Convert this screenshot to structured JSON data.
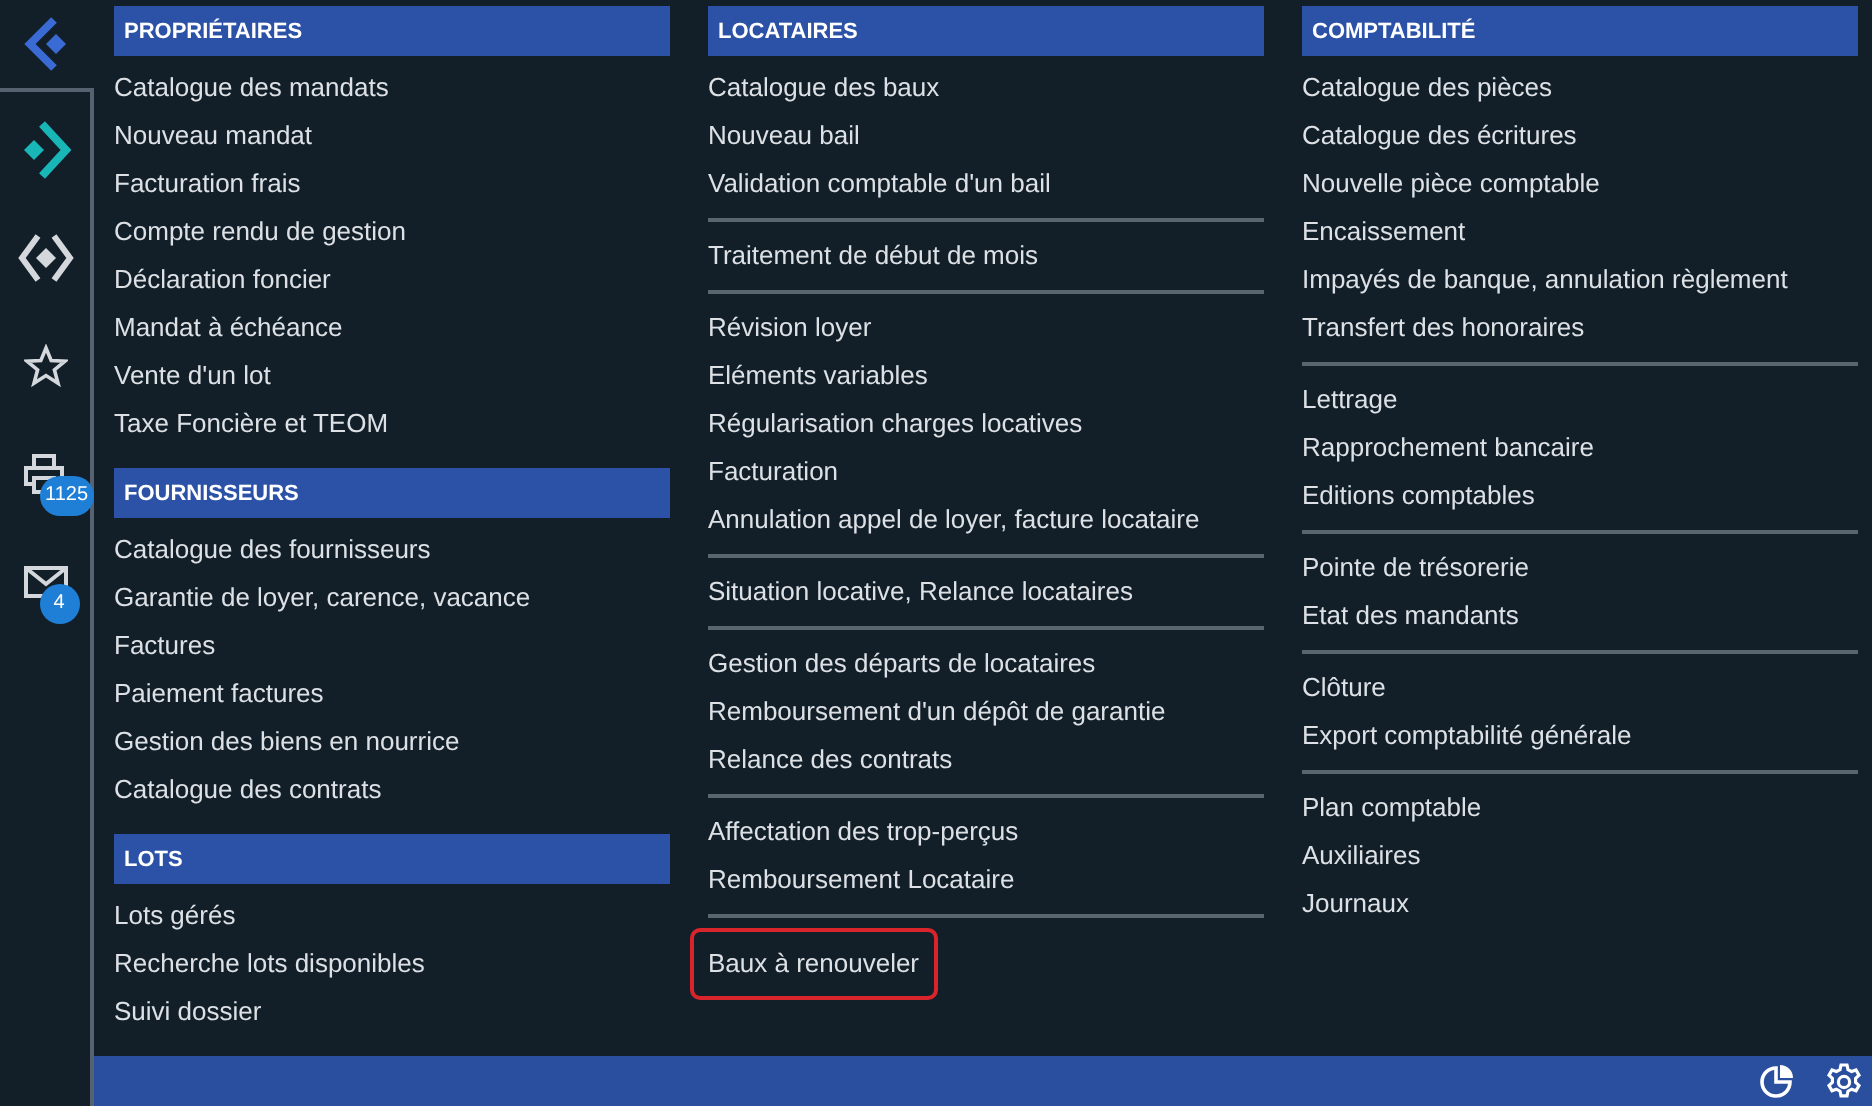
{
  "rail": {
    "items": [
      {
        "kind": "forward",
        "selected": true
      },
      {
        "kind": "diamond",
        "selected": false
      },
      {
        "kind": "star",
        "selected": false
      },
      {
        "kind": "printer",
        "selected": false,
        "badge": "1125"
      },
      {
        "kind": "mail",
        "selected": false,
        "badge": "4"
      }
    ]
  },
  "columns": [
    {
      "sections": [
        {
          "title": "PROPRIÉTAIRES",
          "groups": [
            [
              {
                "label": "Catalogue des mandats",
                "selected": false
              },
              {
                "label": "Nouveau mandat",
                "selected": false
              },
              {
                "label": "Facturation frais",
                "selected": false
              },
              {
                "label": "Compte rendu de gestion",
                "selected": false
              },
              {
                "label": "Déclaration foncier",
                "selected": false
              },
              {
                "label": "Mandat à échéance",
                "selected": false
              },
              {
                "label": "Vente d'un lot",
                "selected": false
              },
              {
                "label": "Taxe Foncière et TEOM",
                "selected": false
              }
            ]
          ]
        },
        {
          "title": "FOURNISSEURS",
          "groups": [
            [
              {
                "label": "Catalogue des fournisseurs",
                "selected": false
              },
              {
                "label": "Garantie de loyer, carence, vacance",
                "selected": false
              },
              {
                "label": "Factures",
                "selected": false
              },
              {
                "label": "Paiement factures",
                "selected": false
              },
              {
                "label": "Gestion des biens en nourrice",
                "selected": false
              },
              {
                "label": "Catalogue des contrats",
                "selected": false
              }
            ]
          ]
        },
        {
          "title": "LOTS",
          "groups": [
            [
              {
                "label": "Lots gérés",
                "selected": false
              },
              {
                "label": "Recherche lots disponibles",
                "selected": false
              },
              {
                "label": "Suivi dossier",
                "selected": false
              }
            ]
          ]
        }
      ]
    },
    {
      "sections": [
        {
          "title": "LOCATAIRES",
          "groups": [
            [
              {
                "label": "Catalogue des baux",
                "selected": false
              },
              {
                "label": "Nouveau bail",
                "selected": false
              },
              {
                "label": "Validation comptable d'un bail",
                "selected": false
              }
            ],
            [
              {
                "label": "Traitement de début de mois",
                "selected": false
              }
            ],
            [
              {
                "label": "Révision loyer",
                "selected": false
              },
              {
                "label": "Eléments variables",
                "selected": false
              },
              {
                "label": "Régularisation charges locatives",
                "selected": false
              },
              {
                "label": "Facturation",
                "selected": false
              },
              {
                "label": "Annulation appel de loyer, facture locataire",
                "selected": false
              }
            ],
            [
              {
                "label": "Situation locative, Relance locataires",
                "selected": false
              }
            ],
            [
              {
                "label": "Gestion des départs de locataires",
                "selected": false
              },
              {
                "label": "Remboursement d'un dépôt de garantie",
                "selected": false
              },
              {
                "label": "Relance des contrats",
                "selected": false
              }
            ],
            [
              {
                "label": "Affectation des trop-perçus",
                "selected": false
              },
              {
                "label": "Remboursement Locataire",
                "selected": false
              }
            ],
            [
              {
                "label": "Baux à renouveler",
                "selected": true
              }
            ]
          ]
        }
      ]
    },
    {
      "sections": [
        {
          "title": "COMPTABILITÉ",
          "groups": [
            [
              {
                "label": "Catalogue des pièces",
                "selected": false
              },
              {
                "label": "Catalogue des écritures",
                "selected": false
              },
              {
                "label": "Nouvelle pièce comptable",
                "selected": false
              },
              {
                "label": "Encaissement",
                "selected": false
              },
              {
                "label": "Impayés de banque, annulation règlement",
                "selected": false
              },
              {
                "label": "Transfert des honoraires",
                "selected": false
              }
            ],
            [
              {
                "label": "Lettrage",
                "selected": false
              },
              {
                "label": "Rapprochement bancaire",
                "selected": false
              },
              {
                "label": "Editions comptables",
                "selected": false
              }
            ],
            [
              {
                "label": "Pointe de trésorerie",
                "selected": false
              },
              {
                "label": "Etat des mandants",
                "selected": false
              }
            ],
            [
              {
                "label": "Clôture",
                "selected": false
              },
              {
                "label": "Export comptabilité générale",
                "selected": false
              }
            ],
            [
              {
                "label": "Plan comptable",
                "selected": false
              },
              {
                "label": "Auxiliaires",
                "selected": false
              },
              {
                "label": "Journaux",
                "selected": false
              }
            ]
          ]
        }
      ]
    }
  ]
}
